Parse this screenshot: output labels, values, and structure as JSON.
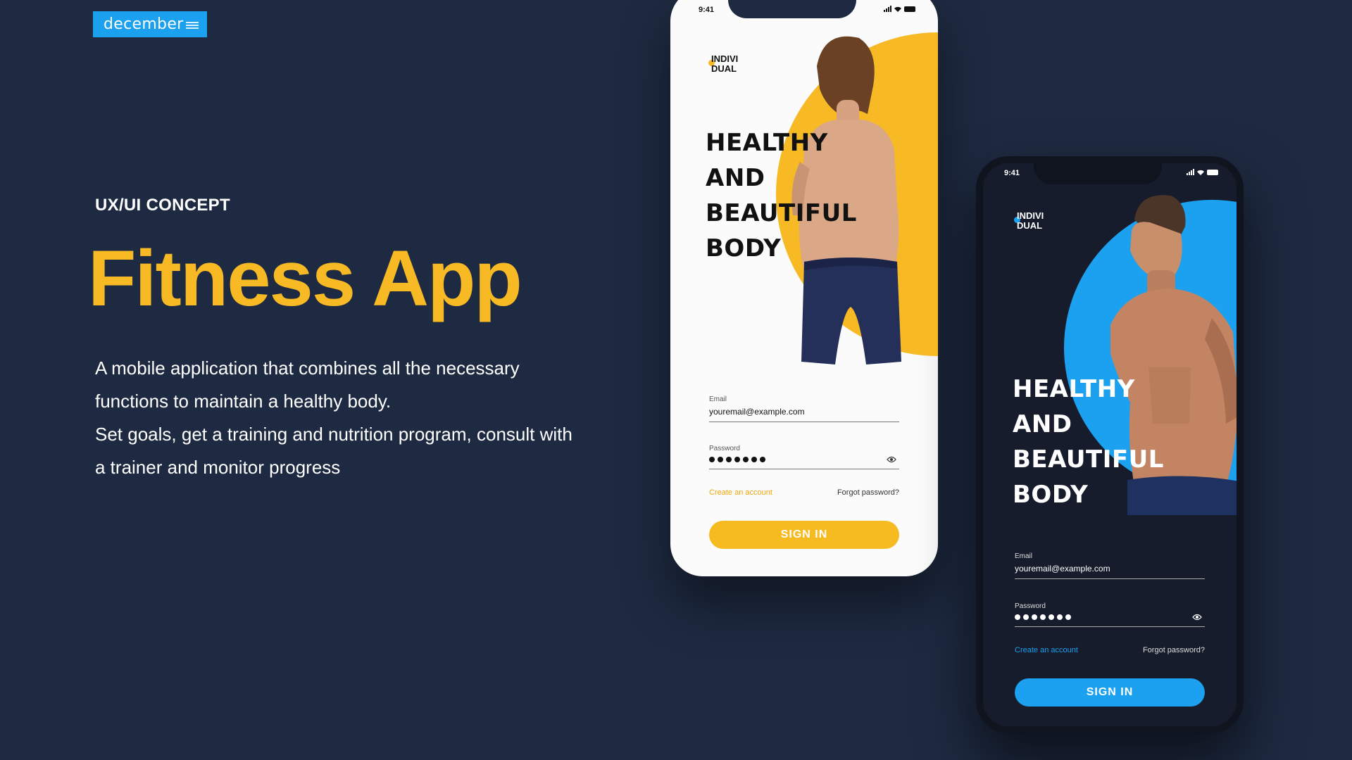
{
  "brand": {
    "name": "december"
  },
  "hero": {
    "kicker": "UX/UI CONCEPT",
    "title": "Fitness App",
    "description": [
      "A mobile application that combines all the necessary functions to maintain a healthy body.",
      "Set goals, get a training and nutrition program, consult with a trainer and monitor progress"
    ]
  },
  "phone_light": {
    "theme": "light",
    "accent_color": "#f7b924",
    "status_time": "9:41",
    "logo": [
      "INDIVI",
      "DUAL"
    ],
    "headline": [
      "HEALTHY",
      "AND",
      "BEAUTIFUL",
      "BODY"
    ],
    "email_label": "Email",
    "email_value": "youremail@example.com",
    "password_label": "Password",
    "password_length": 7,
    "create_account": "Create an account",
    "forgot_password": "Forgot password?",
    "signin": "SIGN IN",
    "photo": "woman-back-photo"
  },
  "phone_dark": {
    "theme": "dark",
    "accent_color": "#1ba1ef",
    "status_time": "9:41",
    "logo": [
      "INDIVI",
      "DUAL"
    ],
    "headline": [
      "HEALTHY",
      "AND",
      "BEAUTIFUL",
      "BODY"
    ],
    "email_label": "Email",
    "email_value": "youremail@example.com",
    "password_label": "Password",
    "password_length": 7,
    "create_account": "Create an account",
    "forgot_password": "Forgot password?",
    "signin": "SIGN IN",
    "photo": "man-torso-photo"
  },
  "icons": {
    "signal": "signal-icon",
    "wifi": "wifi-icon",
    "battery": "battery-icon",
    "eye": "eye-icon"
  }
}
